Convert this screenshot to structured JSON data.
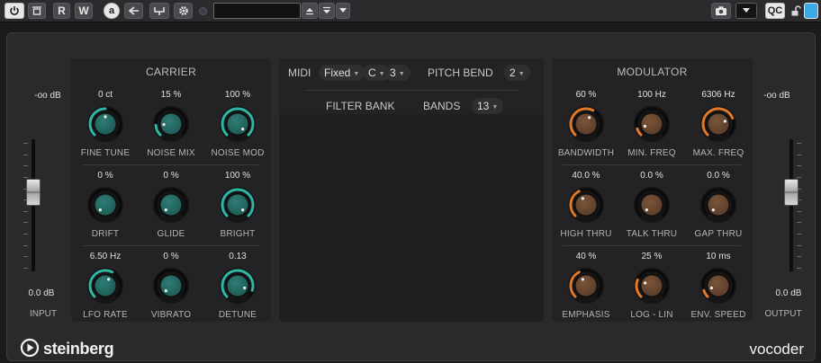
{
  "toolbar": {
    "r_label": "R",
    "w_label": "W",
    "a_label": "a",
    "qc_label": "QC"
  },
  "carrier": {
    "title": "CARRIER",
    "knobs": [
      {
        "label": "FINE TUNE",
        "value": "0 ct",
        "fraction": 0.5
      },
      {
        "label": "NOISE MIX",
        "value": "15 %",
        "fraction": 0.15
      },
      {
        "label": "NOISE MOD",
        "value": "100 %",
        "fraction": 1.0
      },
      {
        "label": "DRIFT",
        "value": "0 %",
        "fraction": 0.0
      },
      {
        "label": "GLIDE",
        "value": "0 %",
        "fraction": 0.0
      },
      {
        "label": "BRIGHT",
        "value": "100 %",
        "fraction": 1.0
      },
      {
        "label": "LFO RATE",
        "value": "6.50 Hz",
        "fraction": 0.6
      },
      {
        "label": "VIBRATO",
        "value": "0 %",
        "fraction": 0.0
      },
      {
        "label": "DETUNE",
        "value": "0.13",
        "fraction": 0.9
      }
    ]
  },
  "center": {
    "midi_label": "MIDI",
    "midi_mode": "Fixed",
    "midi_note": "C",
    "midi_octave": "3",
    "pitch_bend_label": "PITCH BEND",
    "pitch_bend_value": "2",
    "filter_bank_label": "FILTER BANK",
    "bands_label": "BANDS",
    "bands_value": "13"
  },
  "modulator": {
    "title": "MODULATOR",
    "knobs": [
      {
        "label": "BANDWIDTH",
        "value": "60 %",
        "fraction": 0.6
      },
      {
        "label": "MIN. FREQ",
        "value": "100 Hz",
        "fraction": 0.1
      },
      {
        "label": "MAX. FREQ",
        "value": "6306 Hz",
        "fraction": 0.75
      },
      {
        "label": "HIGH THRU",
        "value": "40.0 %",
        "fraction": 0.4
      },
      {
        "label": "TALK THRU",
        "value": "0.0 %",
        "fraction": 0.0
      },
      {
        "label": "GAP THRU",
        "value": "0.0 %",
        "fraction": 0.0
      },
      {
        "label": "EMPHASIS",
        "value": "40 %",
        "fraction": 0.4
      },
      {
        "label": "LOG - LIN",
        "value": "25 %",
        "fraction": 0.25
      },
      {
        "label": "ENV. SPEED",
        "value": "10 ms",
        "fraction": 0.1
      }
    ]
  },
  "input": {
    "label": "INPUT",
    "peak": "-oo dB",
    "gain": "0.0 dB",
    "fader_fraction": 0.6
  },
  "output": {
    "label": "OUTPUT",
    "peak": "-oo dB",
    "gain": "0.0 dB",
    "fader_fraction": 0.6
  },
  "brand": "steinberg",
  "plugin_name": "vocoder",
  "colors": {
    "carrier_accent": "#2fb6a4",
    "modulator_accent": "#e07a2a",
    "background": "#2a2a2c",
    "panel": "#232325"
  },
  "icons": [
    "power-icon",
    "bypass-icon",
    "arrow-left-icon",
    "route-icon",
    "gear-icon",
    "arrow-up-icon",
    "arrow-down-icon",
    "chevron-down-icon",
    "camera-icon",
    "lock-icon",
    "steinberg-logo-icon"
  ]
}
